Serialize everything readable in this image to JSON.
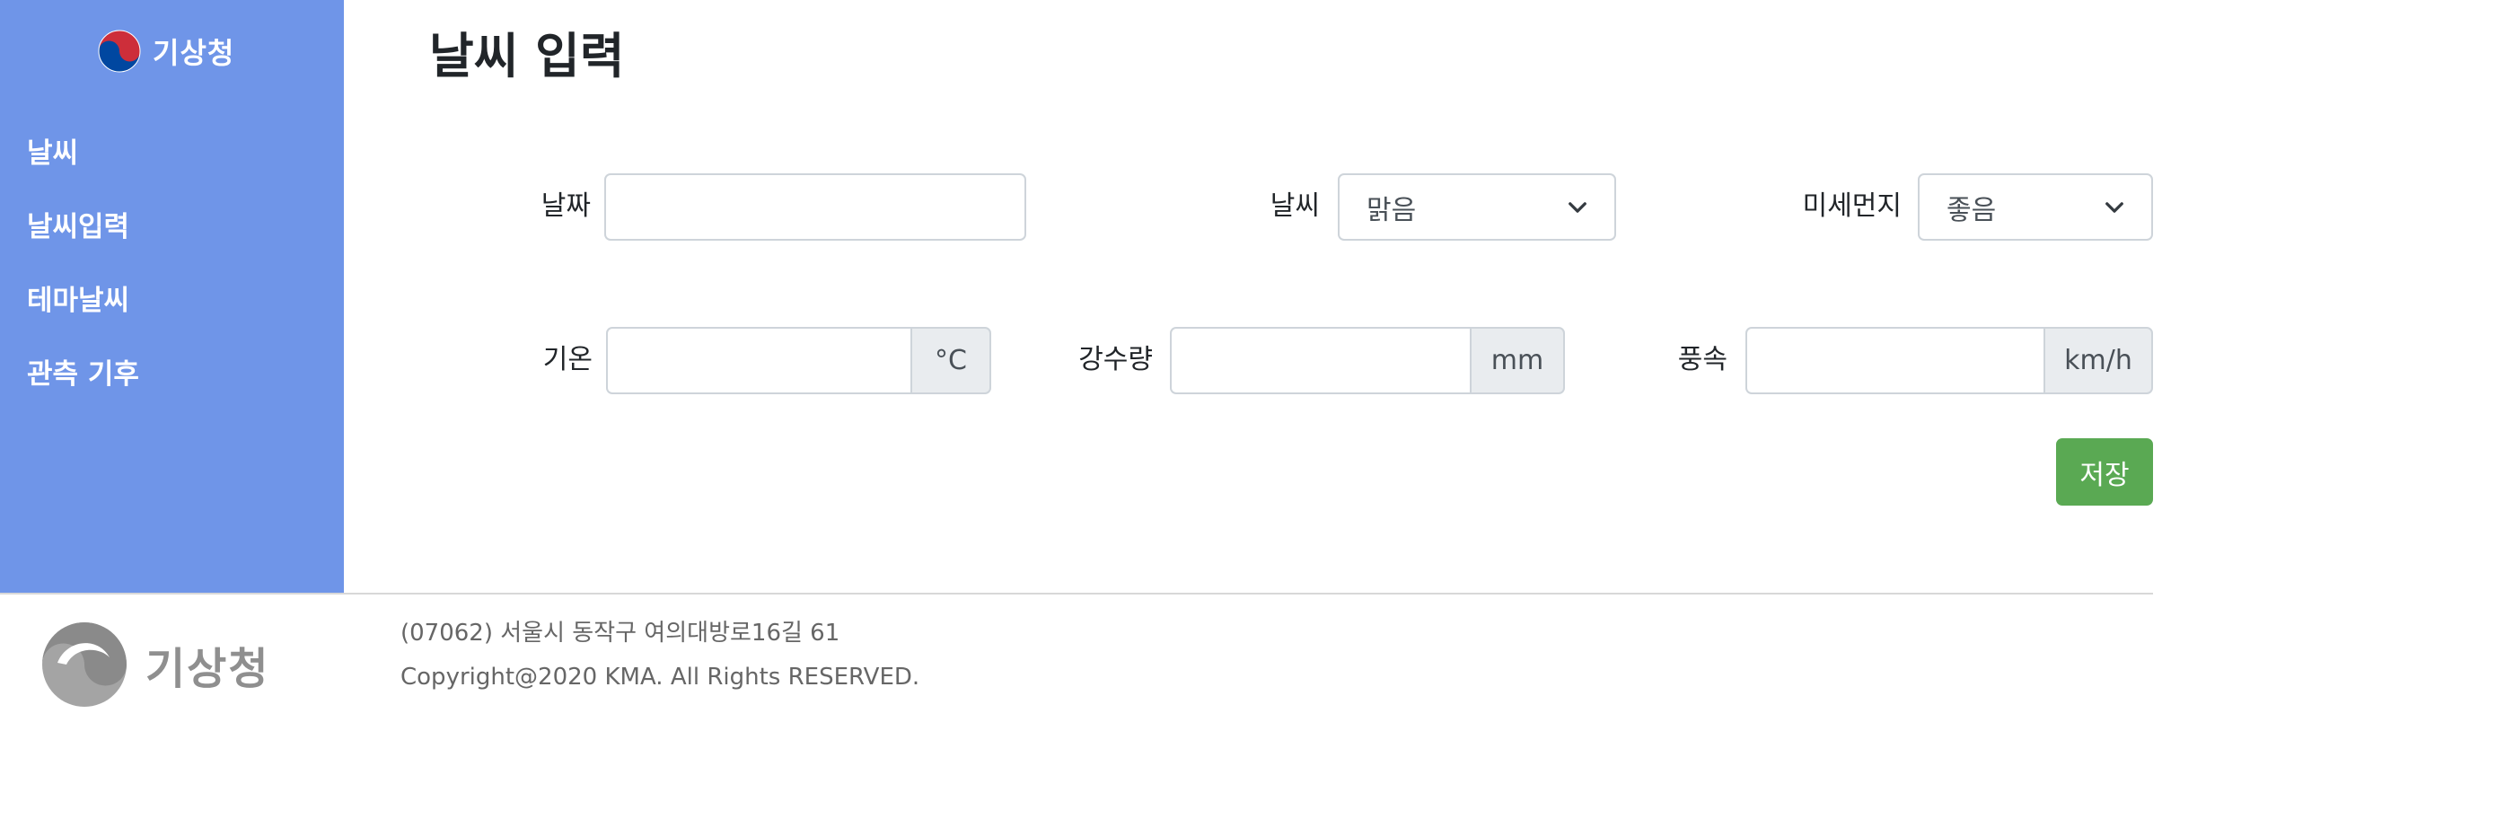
{
  "sidebar": {
    "brand": "기상청",
    "items": [
      {
        "label": "날씨"
      },
      {
        "label": "날씨입력"
      },
      {
        "label": "테마날씨"
      },
      {
        "label": "관측 기후"
      }
    ]
  },
  "main": {
    "title": "날씨 입력",
    "form": {
      "date_label": "날짜",
      "date_value": "",
      "weather_label": "날씨",
      "weather_selected": "맑음",
      "dust_label": "미세먼지",
      "dust_selected": "좋음",
      "temp_label": "기온",
      "temp_value": "",
      "temp_unit": "°C",
      "rain_label": "강수량",
      "rain_value": "",
      "rain_unit": "mm",
      "wind_label": "풍속",
      "wind_value": "",
      "wind_unit": "km/h",
      "save_label": "저장"
    }
  },
  "footer": {
    "logo_text": "기상청",
    "address": "(07062) 서울시 동작구 여의대방로16길 61",
    "copyright": "Copyright@2020 KMA. All Rights RESERVED."
  },
  "colors": {
    "sidebar_bg": "#6f95e8",
    "save_button": "#5aa953",
    "logo_red": "#cd2e3a",
    "logo_blue": "#0047a0"
  }
}
